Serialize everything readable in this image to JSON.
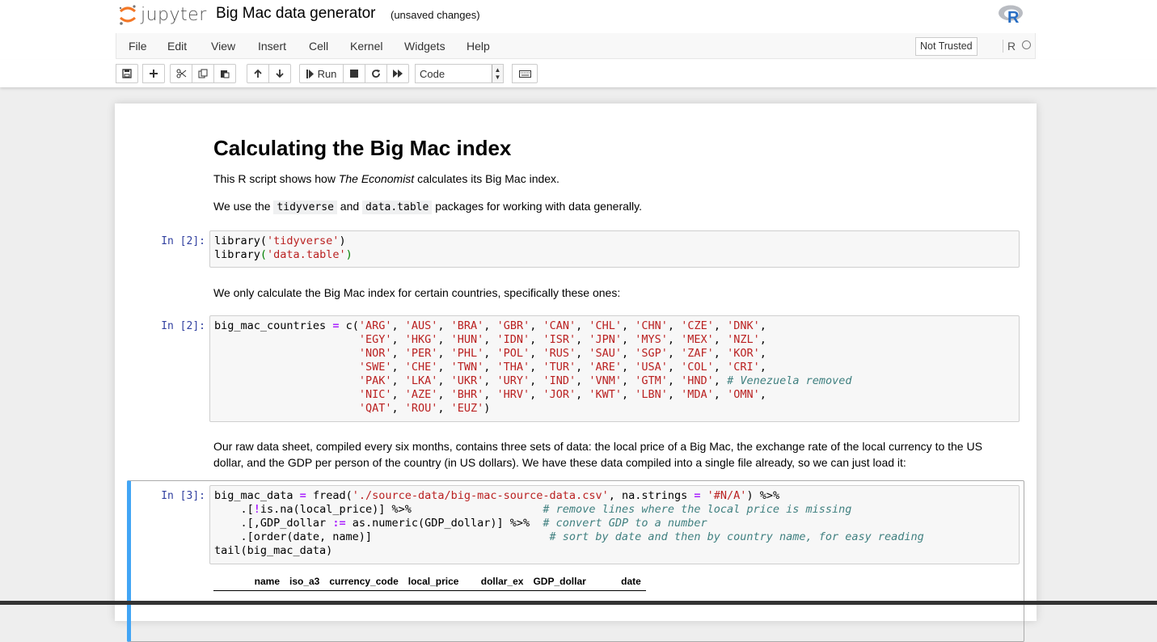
{
  "header": {
    "logo_text": "jupyter",
    "notebook_title": "Big Mac data generator",
    "save_status": "(unsaved changes)",
    "kernel_logo": "R"
  },
  "menubar": {
    "items": [
      "File",
      "Edit",
      "View",
      "Insert",
      "Cell",
      "Kernel",
      "Widgets",
      "Help"
    ],
    "trusted": "Not Trusted",
    "kernel_name": "R"
  },
  "toolbar": {
    "run_label": "Run",
    "cell_type": "Code",
    "icons": [
      "save-icon",
      "plus-icon",
      "cut-icon",
      "copy-icon",
      "paste-icon",
      "arrow-up-icon",
      "arrow-down-icon",
      "step-forward-icon",
      "stop-icon",
      "restart-icon",
      "fast-forward-icon",
      "keyboard-icon"
    ]
  },
  "notebook": {
    "heading": "Calculating the Big Mac index",
    "p1_pre": "This R script shows how ",
    "p1_em": "The Economist",
    "p1_post": " calculates its Big Mac index.",
    "p2_pre": "We use the ",
    "p2_code1": "tidyverse",
    "p2_mid": " and ",
    "p2_code2": "data.table",
    "p2_post": " packages for working with data generally.",
    "p3": "We only calculate the Big Mac index for certain countries, specifically these ones:",
    "p4_line1": "Our raw data sheet, compiled every six months, contains three sets of data: the local price of a Big Mac, the exchange rate of the local currency to the US",
    "p4_line2": "dollar, and the GDP per person of the country (in US dollars). We have these data compiled into a single file already, so we can just load it:",
    "prompts": [
      "In [2]:",
      "In [2]:",
      "In [3]:"
    ],
    "table_headers": [
      "name",
      "iso_a3",
      "currency_code",
      "local_price",
      "dollar_ex",
      "GDP_dollar",
      "date"
    ]
  },
  "colors": {
    "selected_border": "#42a5f5",
    "prompt": "#303f9f",
    "string": "#ba2121",
    "comment": "#408080",
    "operator": "#aa22ff"
  }
}
